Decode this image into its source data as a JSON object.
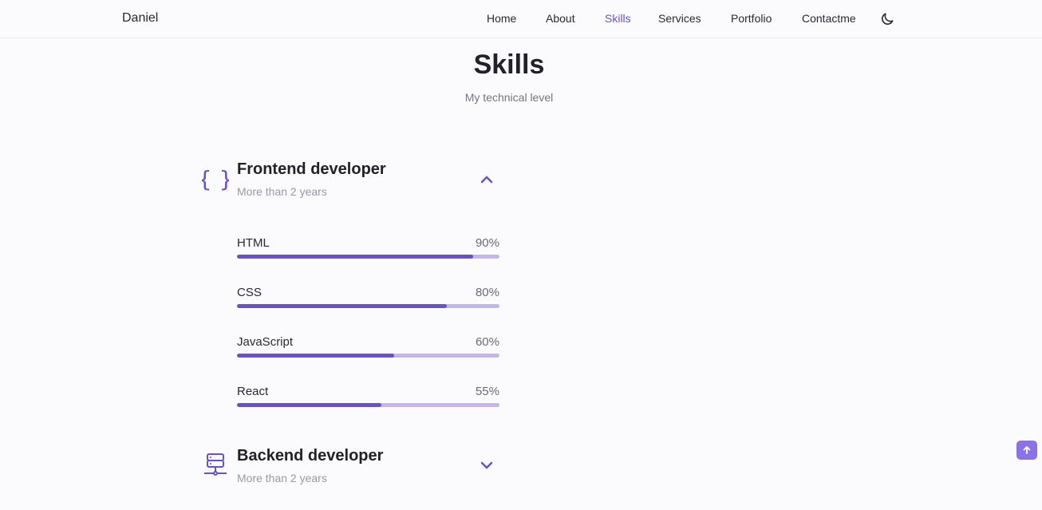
{
  "header": {
    "logo": "Daniel",
    "nav": [
      {
        "label": "Home",
        "active": false
      },
      {
        "label": "About",
        "active": false
      },
      {
        "label": "Skills",
        "active": true
      },
      {
        "label": "Services",
        "active": false
      },
      {
        "label": "Portfolio",
        "active": false
      },
      {
        "label": "Contactme",
        "active": false
      }
    ],
    "theme_toggle_icon": "moon-icon"
  },
  "section": {
    "title": "Skills",
    "subtitle": "My technical level"
  },
  "groups": [
    {
      "title": "Frontend developer",
      "subtitle": "More than 2 years",
      "icon": "braces-icon",
      "expanded": true,
      "toggle_icon": "chevron-up-icon",
      "skills": [
        {
          "name": "HTML",
          "percent_label": "90%",
          "percent": 90
        },
        {
          "name": "CSS",
          "percent_label": "80%",
          "percent": 80
        },
        {
          "name": "JavaScript",
          "percent_label": "60%",
          "percent": 60
        },
        {
          "name": "React",
          "percent_label": "55%",
          "percent": 55
        }
      ]
    },
    {
      "title": "Backend developer",
      "subtitle": "More than 2 years",
      "icon": "server-icon",
      "expanded": false,
      "toggle_icon": "chevron-down-icon"
    }
  ],
  "scroll_up_icon": "arrow-up-icon",
  "colors": {
    "accent": "#6b4fd1",
    "accent_light": "#c3b6f0",
    "background": "#fbfbfe",
    "text": "#2a2833"
  }
}
